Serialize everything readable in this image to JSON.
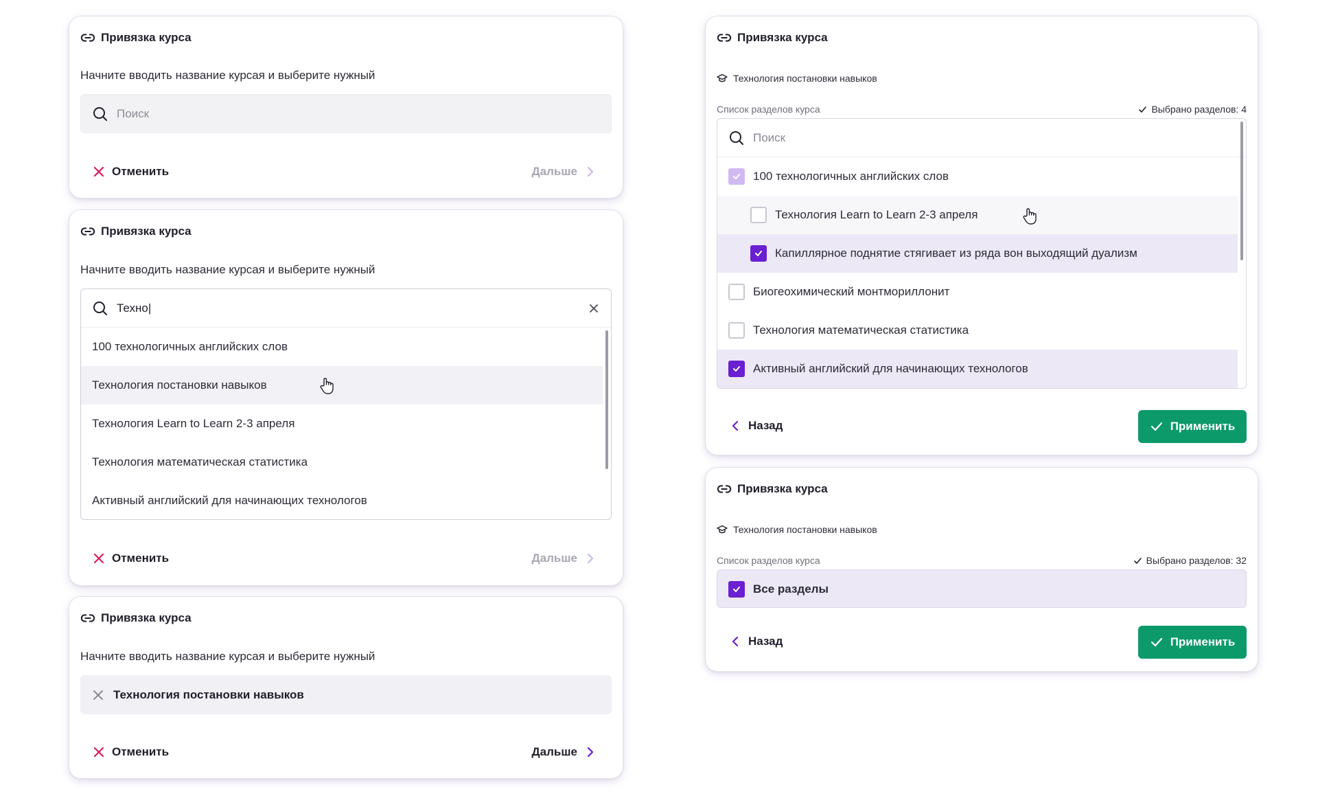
{
  "common": {
    "card_title": "Привязка курса",
    "hint": "Начните вводить название курсая и выберите нужный",
    "search_placeholder": "Поиск",
    "cancel_label": "Отменить",
    "next_label": "Дальше",
    "back_label": "Назад",
    "apply_label": "Применить",
    "sections_label": "Список разделов курса"
  },
  "card2": {
    "query": "Техно|",
    "results": [
      "100 технологичных английских слов",
      "Технология постановки навыков",
      "Технология Learn to Learn 2-3 апреля",
      "Технология математическая статистика",
      "Активный английский для начинающих технологов"
    ]
  },
  "card3": {
    "selected_course": "Технология постановки навыков"
  },
  "card4": {
    "course": "Технология постановки навыков",
    "selected_count": "Выбрано разделов: 4",
    "sections": [
      {
        "label": "100 технологичных английских слов",
        "state": "partial"
      },
      {
        "label": "Технология Learn to Learn 2-3 апреля",
        "state": "off"
      },
      {
        "label": "Капиллярное поднятие стягивает из ряда вон выходящий дуализм",
        "state": "on"
      },
      {
        "label": "Биогеохимический монтмориллонит",
        "state": "off"
      },
      {
        "label": "Технология математическая статистика",
        "state": "off"
      },
      {
        "label": "Активный английский для начинающих технологов",
        "state": "on"
      }
    ]
  },
  "card5": {
    "course": "Технология постановки навыков",
    "selected_count": "Выбрано разделов: 32",
    "all_sections": "Все разделы"
  },
  "colors": {
    "accent": "#6a1fd1",
    "cancel": "#d81b60",
    "apply": "#0c9a6a",
    "selected_row": "#ece8f6"
  }
}
